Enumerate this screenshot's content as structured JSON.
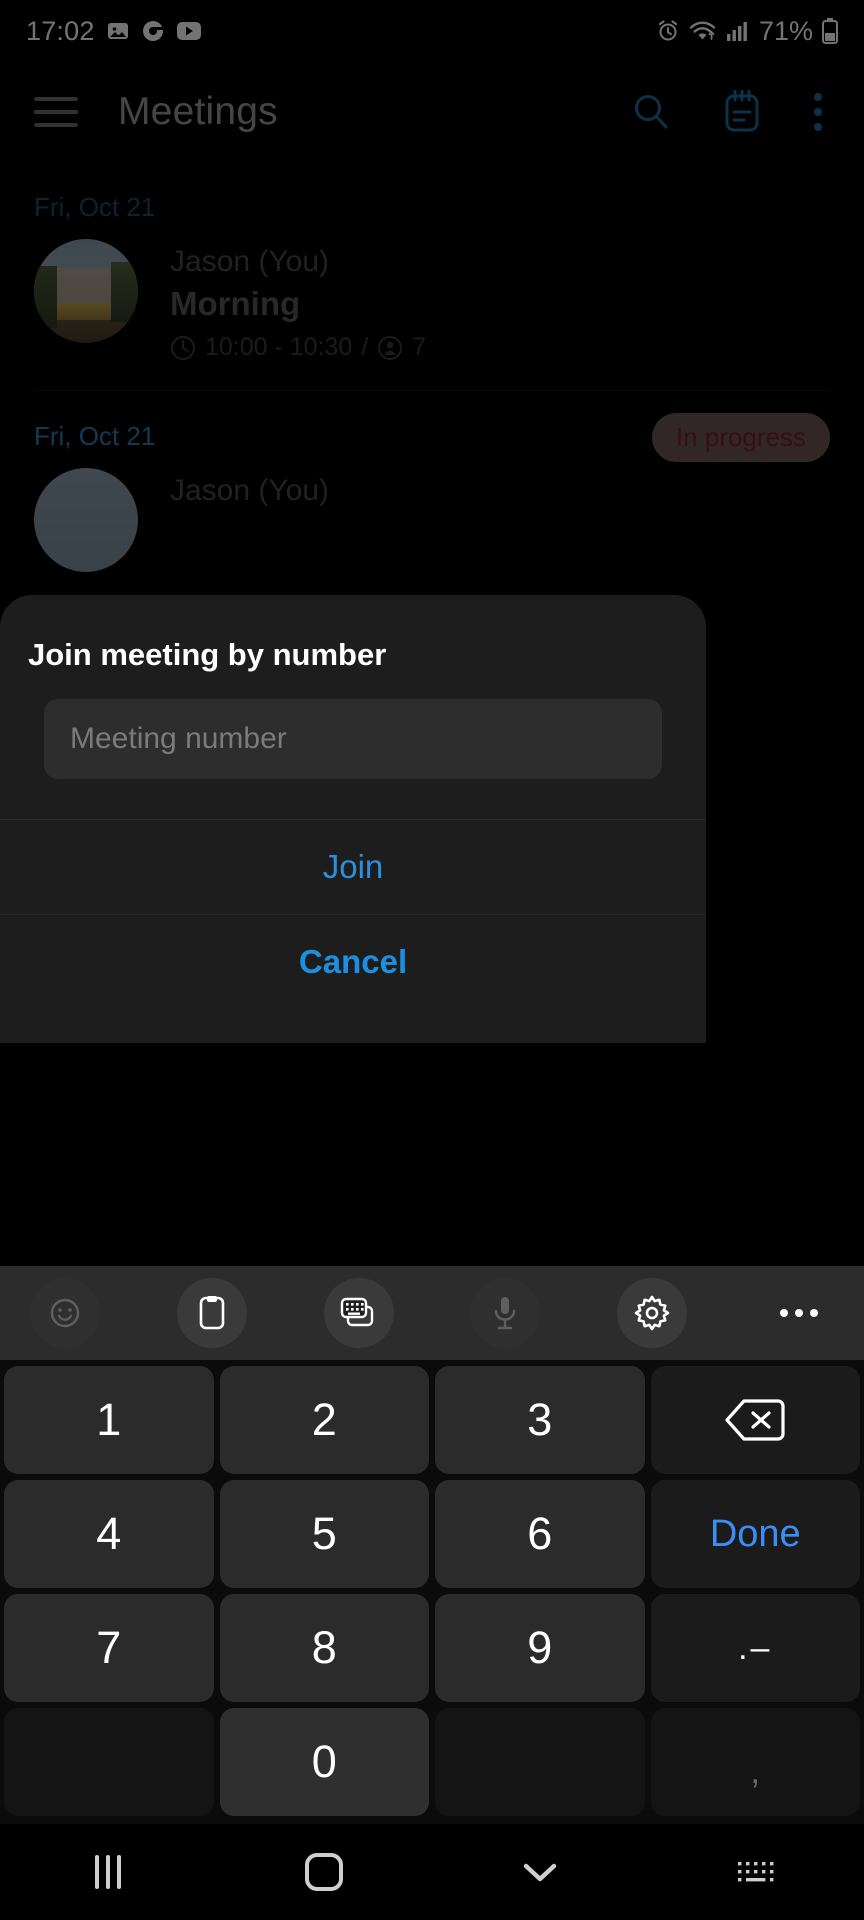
{
  "status_bar": {
    "time": "17:02",
    "left_icons": [
      "image-icon",
      "chrome-icon",
      "youtube-icon"
    ],
    "right_icons": [
      "alarm-icon",
      "wifi-icon",
      "signal-icon",
      "battery-icon"
    ],
    "battery_percent": "71%"
  },
  "app_bar": {
    "menu_icon": "hamburger-icon",
    "title": "Meetings",
    "actions": [
      "search-icon",
      "calendar-notes-icon",
      "overflow-menu-icon"
    ],
    "accent_color": "#1b6ea0"
  },
  "meetings": [
    {
      "date": "Fri, Oct 21",
      "host": "Jason (You)",
      "title": "Morning",
      "time_range": "10:00 - 10:30",
      "separator": "/",
      "participants": "7",
      "clock_icon": "clock-icon",
      "people_icon": "person-icon",
      "status": ""
    },
    {
      "date": "Fri, Oct 21",
      "host": "Jason (You)",
      "title": "",
      "time_range": "",
      "separator": "",
      "participants": "",
      "clock_icon": "clock-icon",
      "people_icon": "person-icon",
      "status": "In progress"
    }
  ],
  "dialog": {
    "title": "Join meeting by number",
    "input_value": "",
    "input_placeholder": "Meeting number",
    "join_label": "Join",
    "cancel_label": "Cancel",
    "accent_color": "#1e8fe0"
  },
  "keyboard": {
    "toolbar_icons": [
      "emoji-icon",
      "clipboard-icon",
      "keyboard-modes-icon",
      "microphone-icon",
      "settings-gear-icon",
      "more-options-icon"
    ],
    "keys": [
      {
        "label": "1",
        "name": "key-1",
        "style": "num"
      },
      {
        "label": "2",
        "name": "key-2",
        "style": "num"
      },
      {
        "label": "3",
        "name": "key-3",
        "style": "num"
      },
      {
        "label": "",
        "name": "key-backspace",
        "style": "backspace"
      },
      {
        "label": "4",
        "name": "key-4",
        "style": "num"
      },
      {
        "label": "5",
        "name": "key-5",
        "style": "num"
      },
      {
        "label": "6",
        "name": "key-6",
        "style": "num"
      },
      {
        "label": "Done",
        "name": "key-done",
        "style": "done"
      },
      {
        "label": "7",
        "name": "key-7",
        "style": "num"
      },
      {
        "label": "8",
        "name": "key-8",
        "style": "num"
      },
      {
        "label": "9",
        "name": "key-9",
        "style": "num"
      },
      {
        "label": ".–",
        "name": "key-dot-dash",
        "style": "punct"
      },
      {
        "label": "",
        "name": "key-blank-left",
        "style": "blank"
      },
      {
        "label": "0",
        "name": "key-0",
        "style": "zero"
      },
      {
        "label": "",
        "name": "key-blank-right",
        "style": "blank"
      },
      {
        "label": ",",
        "name": "key-comma",
        "style": "comma"
      }
    ]
  },
  "nav_bar": {
    "items": [
      "recents-icon",
      "home-icon",
      "hide-keyboard-icon",
      "keyboard-switcher-icon"
    ]
  }
}
